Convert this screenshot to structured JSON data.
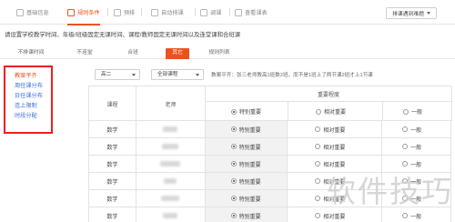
{
  "nav": {
    "items": [
      {
        "label": "基础信息",
        "active": false
      },
      {
        "label": "规则条件",
        "active": true
      },
      {
        "label": "预排",
        "active": false
      },
      {
        "label": "自动排课",
        "active": false
      },
      {
        "label": "调课",
        "active": false
      },
      {
        "label": "查看课表",
        "active": false
      }
    ],
    "sort_button": "排课遇到难题"
  },
  "notice": "请设置学校教学时间、年级/班级固定无课时间、课程/教师固定无课时间以及连堂课和合班课",
  "subtabs": [
    "不排课时间",
    "不连堂",
    "合班",
    "其它",
    "规则列表"
  ],
  "sidebar": [
    "教案平齐",
    "周任课分布",
    "日任课分布",
    "连上限制",
    "时段分配"
  ],
  "filters": {
    "grade": "高二",
    "course": "全部课程",
    "hint": "教案平齐：张三老师教高1班数2班，而不是1班上了两节课2班才上1节课"
  },
  "table": {
    "headers": {
      "course": "课程",
      "teacher": "老师",
      "importance": "重要程度"
    },
    "options": [
      "特别重要",
      "相对重要",
      "一般"
    ],
    "rows": [
      {
        "course": "数学"
      },
      {
        "course": "数学"
      },
      {
        "course": "数学"
      },
      {
        "course": "数学"
      },
      {
        "course": "数学"
      },
      {
        "course": "数学"
      }
    ]
  },
  "watermark": "软件技巧",
  "colors": {
    "accent": "#e8541e",
    "sidebar_border": "#e8211d",
    "link": "#3a6fd8"
  }
}
